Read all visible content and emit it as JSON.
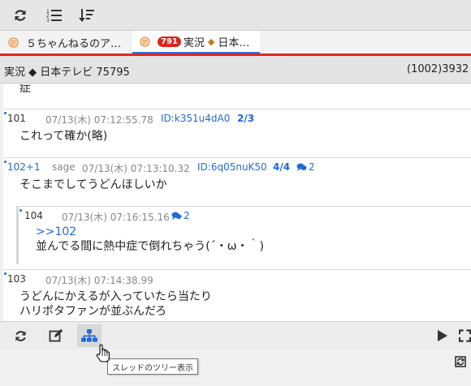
{
  "tabs": [
    {
      "label": "５ちゃんねるのア…"
    },
    {
      "badge": "791",
      "label_a": "実況",
      "label_b": "日本…"
    }
  ],
  "thread": {
    "title_a": "実況",
    "title_b": "日本テレビ 75795",
    "count": "(1002)3932"
  },
  "posts": [
    {
      "partial_text": "症"
    },
    {
      "num": "101",
      "date": "07/13(木) 07:12:55.78",
      "id": "ID:k351u4dA0",
      "count": "2/3",
      "lines": [
        "これって確か(略)"
      ]
    },
    {
      "num": "102+1",
      "name": "sage",
      "date": "07/13(木) 07:13:10.32",
      "id": "ID:6q05nuK50",
      "count": "4/4",
      "replies": "2",
      "lines": [
        "そこまでしてうどんほしいか"
      ]
    },
    {
      "num": "104",
      "date": "07/13(木) 07:16:15.16",
      "replies": "2",
      "anchor": ">>102",
      "lines": [
        "並んでる間に熱中症で倒れちゃう(´・ω・｀)"
      ]
    },
    {
      "num": "103",
      "date": "07/13(木) 07:14:38.99",
      "lines": [
        "うどんにかえるが入っていたら当たり",
        "ハリポタファンが並ぶんだろ"
      ]
    }
  ],
  "tooltip": "スレッドのツリー表示",
  "colors": {
    "accent": "#1f6ad6",
    "tab_underline": "#2f6fd6",
    "red_line": "#e0261f",
    "badge": "#d9261c",
    "diamond": "#c77a16"
  },
  "icons": {
    "toolbar": [
      "refresh-icon",
      "numbered-list-icon",
      "sort-desc-icon"
    ],
    "bottom": [
      "refresh-icon",
      "edit-icon",
      "tree-icon",
      "play-icon",
      "expand-icon",
      "sync-icon"
    ]
  }
}
